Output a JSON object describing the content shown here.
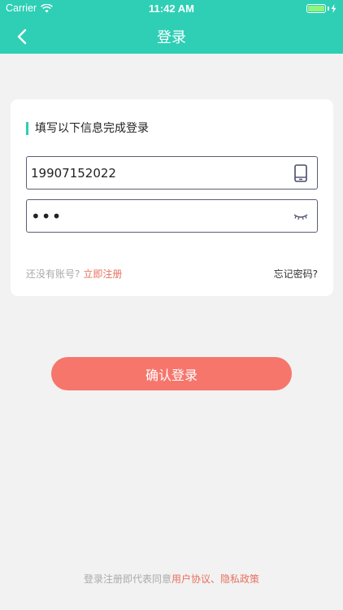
{
  "status_bar": {
    "carrier": "Carrier",
    "time": "11:42 AM"
  },
  "nav": {
    "back_icon": "chevron-left-icon",
    "title": "登录"
  },
  "card": {
    "title": "填写以下信息完成登录",
    "phone_value": "19907152022",
    "phone_icon": "phone-icon",
    "password_value": "•••",
    "password_icon": "eye-closed-icon",
    "register_prompt": "还没有账号?",
    "register_link": "立即注册",
    "forgot_link": "忘记密码?"
  },
  "confirm_label": "确认登录",
  "footer": {
    "prefix": "登录注册即代表同意",
    "agreement_link": "用户协议",
    "separator": "、",
    "privacy_link": "隐私政策"
  },
  "colors": {
    "accent": "#2ecfb5",
    "button": "#f6766c",
    "link": "#e8705f",
    "background": "#f2f2f2"
  }
}
